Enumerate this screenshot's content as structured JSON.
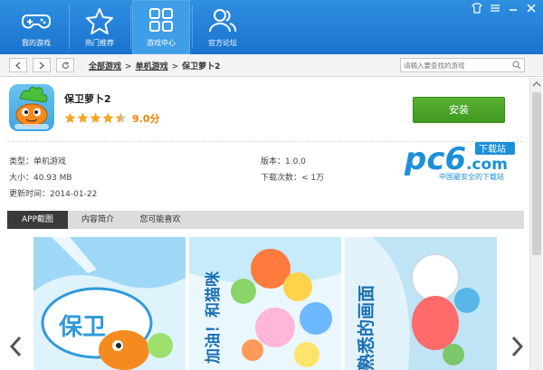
{
  "nav": {
    "items": [
      {
        "label": "我的游戏",
        "icon": "gamepad-icon"
      },
      {
        "label": "热门推荐",
        "icon": "star-icon"
      },
      {
        "label": "游戏中心",
        "icon": "grid-icon"
      },
      {
        "label": "官方论坛",
        "icon": "users-icon"
      }
    ],
    "active_index": 2
  },
  "toolbar": {
    "breadcrumb": [
      "全部游戏",
      "单机游戏",
      "保卫萝卜2"
    ],
    "separator": ">",
    "search_placeholder": "请输入要查找的游戏"
  },
  "app": {
    "name": "保卫萝卜2",
    "rating_value": 4.5,
    "rating_max": 5,
    "rating_text": "9.0分",
    "install_label": "安装"
  },
  "meta": {
    "type": "类型：单机游戏",
    "size": "大小：40.93 MB",
    "updated": "更新时间：2014-01-22",
    "version": "版本：1.0.0",
    "downloads": "下载次数：< 1万"
  },
  "watermark": {
    "brand": "pc6",
    "dot_com": ".com",
    "tag": "下载站",
    "slogan": "中国最安全的下载站"
  },
  "tabs": [
    "APP截图",
    "内容简介",
    "您可能喜欢"
  ],
  "screenshots": {
    "captions": [
      "保卫",
      "加油！和猫咪",
      "熟悉的画面"
    ]
  },
  "colors": {
    "nav_bg": "#1a73cf",
    "install_green": "#4aa427",
    "rating_orange": "#f08400"
  }
}
